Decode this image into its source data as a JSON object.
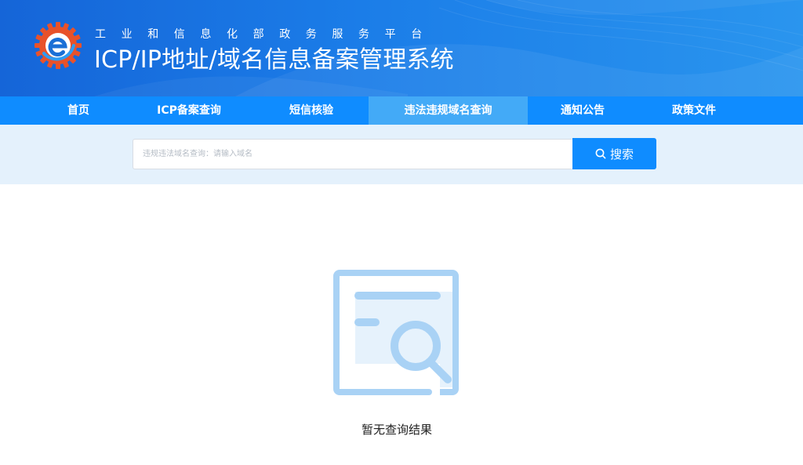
{
  "header": {
    "subtitle": "工业和信息化部政务服务平台",
    "title": "ICP/IP地址/域名信息备案管理系统",
    "logo_icon": "gear-e-logo",
    "brand_orange": "#e8522a",
    "brand_blue": "#1565d8"
  },
  "nav": {
    "items": [
      {
        "label": "首页"
      },
      {
        "label": "ICP备案查询"
      },
      {
        "label": "短信核验"
      },
      {
        "label": "违法违规域名查询",
        "active": true
      },
      {
        "label": "通知公告"
      },
      {
        "label": "政策文件"
      }
    ],
    "background": "#0f8cff",
    "active_background": "#43aaf7"
  },
  "search": {
    "placeholder": "违规违法域名查询：请输入域名",
    "value": "",
    "button_label": "搜索",
    "button_icon": "search-icon"
  },
  "empty_state": {
    "icon": "document-search-icon",
    "message": "暂无查询结果"
  }
}
